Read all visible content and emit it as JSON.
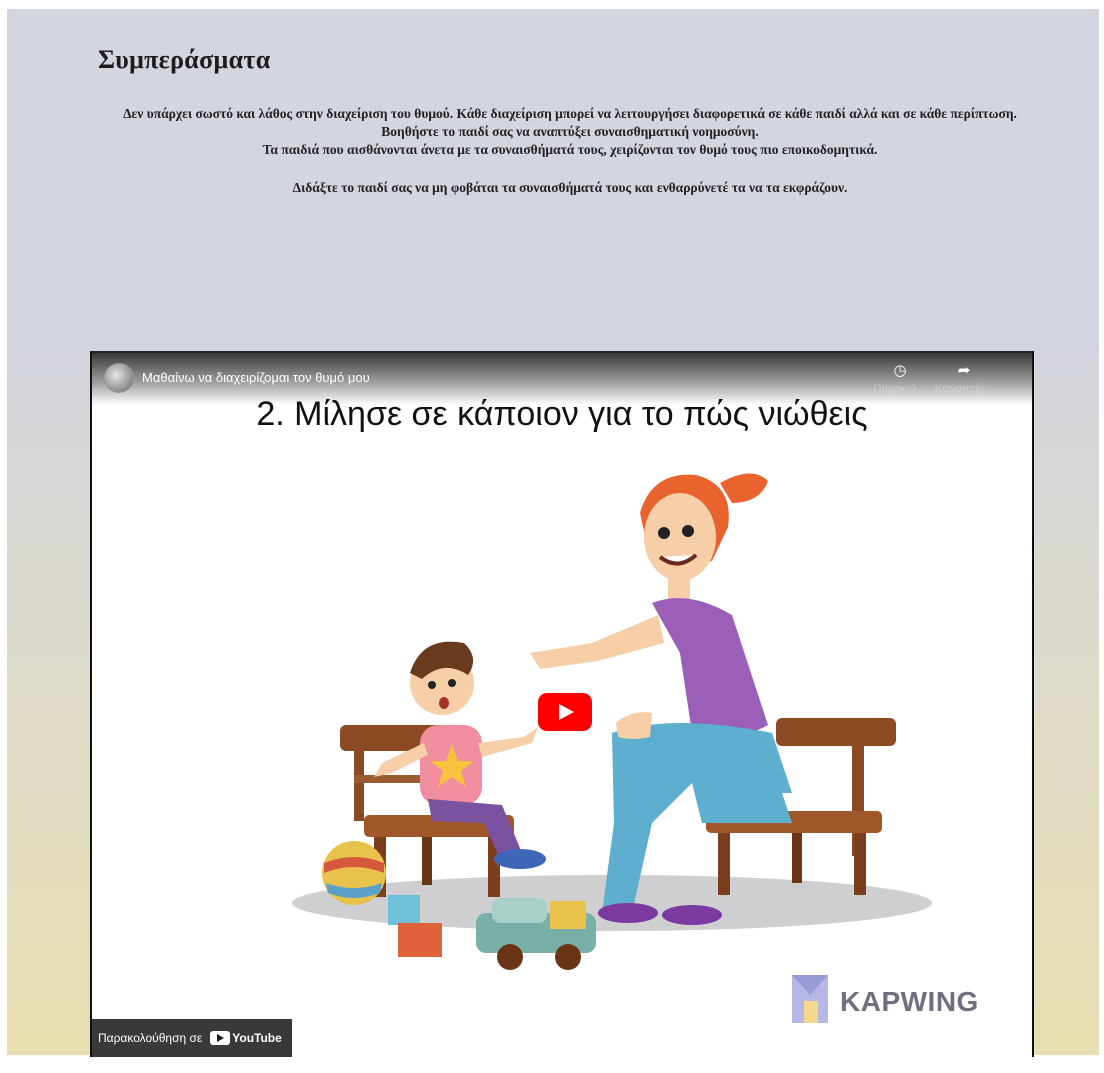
{
  "section": {
    "heading": "Συμπεράσματα",
    "paragraph_1": "Δεν υπάρχει σωστό και λάθος στην διαχείριση του θυμού. Κάθε διαχείριση μπορεί να λειτουργήσει διαφορετικά σε κάθε παιδί αλλά και σε κάθε περίπτωση.",
    "paragraph_2": "Βοηθήστε το παιδί σας να αναπτύξει συναισθηματική νοημοσύνη.",
    "paragraph_3": "Τα παιδιά που αισθάνονται άνετα με τα συναισθήματά τους, χειρίζονται τον θυμό τους πιο εποικοδομητικά.",
    "paragraph_4": "Διδάξτε το παιδί σας να μη φοβάται τα συναισθήματά τους και ενθαρρύνετέ τα να τα εκφράζουν."
  },
  "video": {
    "title": "Μαθαίνω να διαχειρίζομαι τον θυμό μου",
    "watch_later_label": "Παρακολ...",
    "share_label": "Κοινοποίη...",
    "slide_heading": "2. Μίλησε σε κάποιον για το πώς νιώθεις",
    "watermark": "KAPWING",
    "watch_on_label": "Παρακολούθηση σε",
    "youtube_label": "YouTube",
    "icons": {
      "channel": "channel-avatar",
      "watch_later": "clock-icon",
      "share": "share-arrow-icon",
      "play": "youtube-play-icon"
    },
    "colors": {
      "play_button": "#ff0000"
    }
  }
}
